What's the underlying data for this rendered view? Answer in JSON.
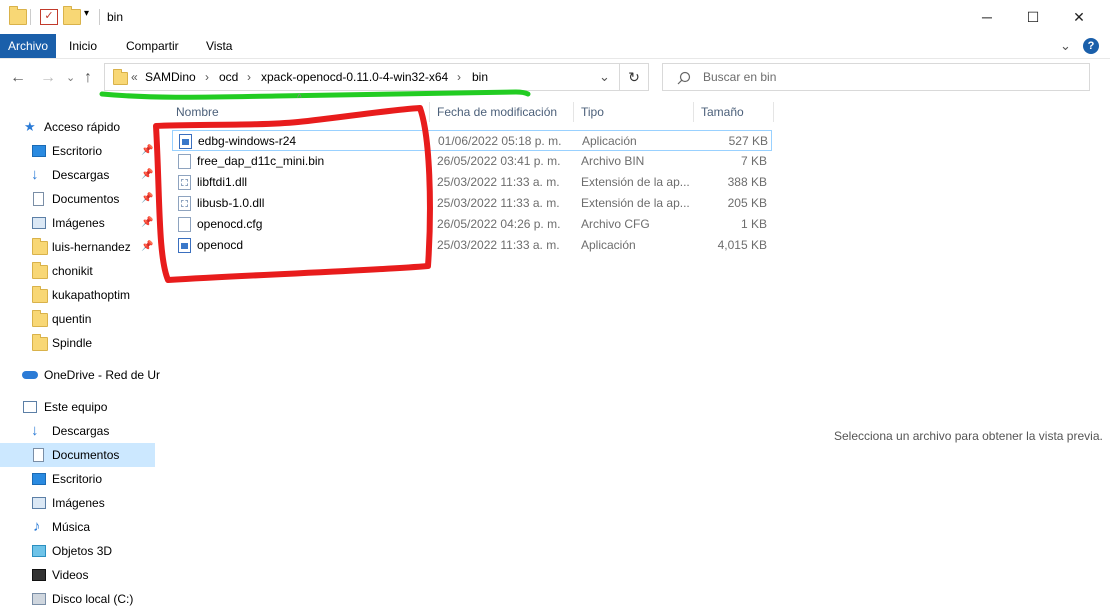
{
  "window": {
    "title": "bin",
    "minimize_glyph": "─",
    "maximize_glyph": "☐",
    "close_glyph": "✕"
  },
  "ribbon": {
    "tabs": [
      "Archivo",
      "Inicio",
      "Compartir",
      "Vista"
    ],
    "expand_glyph": "⌄",
    "help_glyph": "?"
  },
  "nav": {
    "back_glyph": "←",
    "forward_glyph": "→",
    "recent_glyph": "⌄",
    "up_glyph": "↑",
    "refresh_glyph": "↻"
  },
  "address": {
    "overflow": "«",
    "segments": [
      "SAMDino",
      "ocd",
      "xpack-openocd-0.11.0-4-win32-x64",
      "bin"
    ],
    "separator": "›",
    "dropdown_glyph": "⌄"
  },
  "search": {
    "placeholder": "Buscar en bin"
  },
  "columns": {
    "name": "Nombre",
    "date": "Fecha de modificación",
    "type": "Tipo",
    "size": "Tamaño"
  },
  "files": [
    {
      "name": "edbg-windows-r24",
      "date": "01/06/2022 05:18 p. m.",
      "type": "Aplicación",
      "size": "527 KB",
      "icon": "application-icon"
    },
    {
      "name": "free_dap_d11c_mini.bin",
      "date": "26/05/2022 03:41 p. m.",
      "type": "Archivo BIN",
      "size": "7 KB",
      "icon": "file-icon"
    },
    {
      "name": "libftdi1.dll",
      "date": "25/03/2022 11:33 a. m.",
      "type": "Extensión de la ap...",
      "size": "388 KB",
      "icon": "dll-icon"
    },
    {
      "name": "libusb-1.0.dll",
      "date": "25/03/2022 11:33 a. m.",
      "type": "Extensión de la ap...",
      "size": "205 KB",
      "icon": "dll-icon"
    },
    {
      "name": "openocd.cfg",
      "date": "26/05/2022 04:26 p. m.",
      "type": "Archivo CFG",
      "size": "1 KB",
      "icon": "file-icon"
    },
    {
      "name": "openocd",
      "date": "25/03/2022 11:33 a. m.",
      "type": "Aplicación",
      "size": "4,015 KB",
      "icon": "application-icon"
    }
  ],
  "sidebar": {
    "quick_access": "Acceso rápido",
    "quick_items": [
      {
        "label": "Escritorio",
        "icon": "desktop-icon",
        "pinned": true
      },
      {
        "label": "Descargas",
        "icon": "downloads-icon",
        "pinned": true
      },
      {
        "label": "Documentos",
        "icon": "documents-icon",
        "pinned": true
      },
      {
        "label": "Imágenes",
        "icon": "pictures-icon",
        "pinned": true
      },
      {
        "label": "luis-hernandez",
        "icon": "folder-icon",
        "pinned": true
      },
      {
        "label": "chonikit",
        "icon": "folder-icon",
        "pinned": false
      },
      {
        "label": "kukapathoptim",
        "icon": "folder-icon",
        "pinned": false
      },
      {
        "label": "quentin",
        "icon": "folder-icon",
        "pinned": false
      },
      {
        "label": "Spindle",
        "icon": "folder-icon",
        "pinned": false
      }
    ],
    "onedrive": "OneDrive - Red de Ur",
    "this_pc": "Este equipo",
    "pc_items": [
      {
        "label": "Descargas",
        "icon": "downloads-icon"
      },
      {
        "label": "Documentos",
        "icon": "documents-icon",
        "selected": true
      },
      {
        "label": "Escritorio",
        "icon": "desktop-icon"
      },
      {
        "label": "Imágenes",
        "icon": "pictures-icon"
      },
      {
        "label": "Música",
        "icon": "music-icon"
      },
      {
        "label": "Objetos 3D",
        "icon": "3d-objects-icon"
      },
      {
        "label": "Videos",
        "icon": "videos-icon"
      },
      {
        "label": "Disco local (C:)",
        "icon": "drive-icon"
      }
    ]
  },
  "preview": {
    "message": "Selecciona un archivo para obtener la vista previa."
  },
  "annotations": {
    "green_color": "#22cc22",
    "red_color": "#e81c1c"
  }
}
